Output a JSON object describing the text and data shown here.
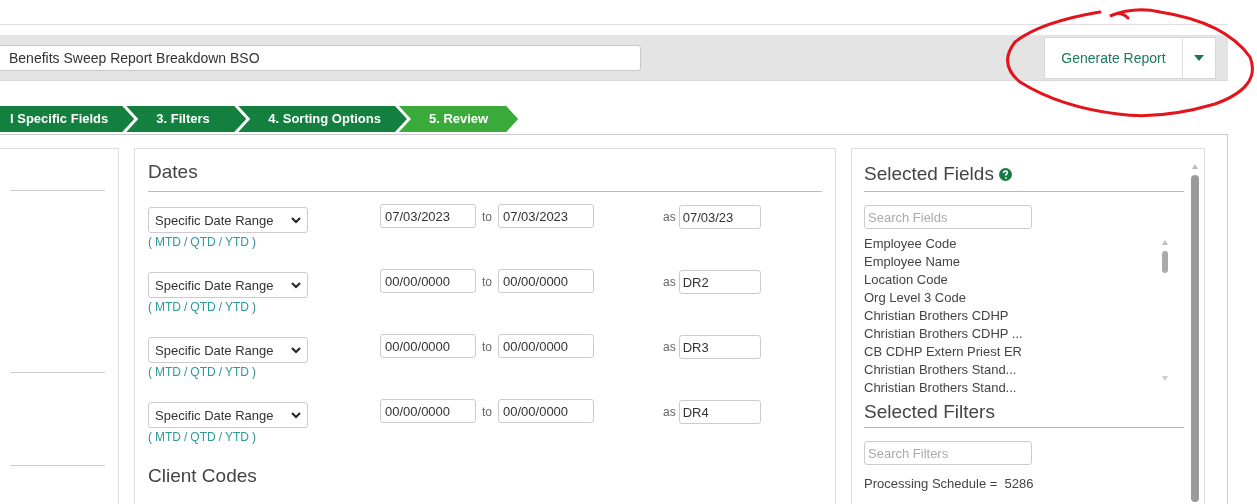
{
  "report_name": {
    "value": "Benefits Sweep Report Breakdown BSO"
  },
  "generate_button": {
    "label": "Generate Report"
  },
  "steps": [
    {
      "label": "l Specific Fields",
      "selected": false
    },
    {
      "label": "3. Filters",
      "selected": false
    },
    {
      "label": "4. Sorting Options",
      "selected": false
    },
    {
      "label": "5. Review",
      "selected": true
    }
  ],
  "dates": {
    "title": "Dates",
    "rows": [
      {
        "range": "Specific Date Range",
        "open": "(",
        "links": [
          "MTD",
          "QTD",
          "YTD"
        ],
        "sep": "/",
        "close": ")",
        "from": "07/03/2023",
        "to_label": "to",
        "to": "07/03/2023",
        "as_label": "as",
        "alias": "07/03/23"
      },
      {
        "range": "Specific Date Range",
        "open": "(",
        "links": [
          "MTD",
          "QTD",
          "YTD"
        ],
        "sep": "/",
        "close": ")",
        "from": "00/00/0000",
        "to_label": "to",
        "to": "00/00/0000",
        "as_label": "as",
        "alias": "DR2"
      },
      {
        "range": "Specific Date Range",
        "open": "(",
        "links": [
          "MTD",
          "QTD",
          "YTD"
        ],
        "sep": "/",
        "close": ")",
        "from": "00/00/0000",
        "to_label": "to",
        "to": "00/00/0000",
        "as_label": "as",
        "alias": "DR3"
      },
      {
        "range": "Specific Date Range",
        "open": "(",
        "links": [
          "MTD",
          "QTD",
          "YTD"
        ],
        "sep": "/",
        "close": ")",
        "from": "00/00/0000",
        "to_label": "to",
        "to": "00/00/0000",
        "as_label": "as",
        "alias": "DR4"
      }
    ]
  },
  "client_codes": {
    "title": "Client Codes"
  },
  "selected_fields": {
    "title": "Selected Fields",
    "search": {
      "placeholder": "Search Fields"
    },
    "items": [
      "Employee Code",
      "Employee Name",
      "Location Code",
      "Org Level 3 Code",
      "Christian Brothers CDHP",
      "Christian Brothers CDHP ...",
      "CB CDHP Extern Priest ER",
      "Christian Brothers Stand...",
      "Christian Brothers Stand..."
    ]
  },
  "selected_filters": {
    "title": "Selected Filters",
    "search": {
      "placeholder": "Search Filters"
    },
    "items": [
      "Processing Schedule =  5286"
    ]
  }
}
